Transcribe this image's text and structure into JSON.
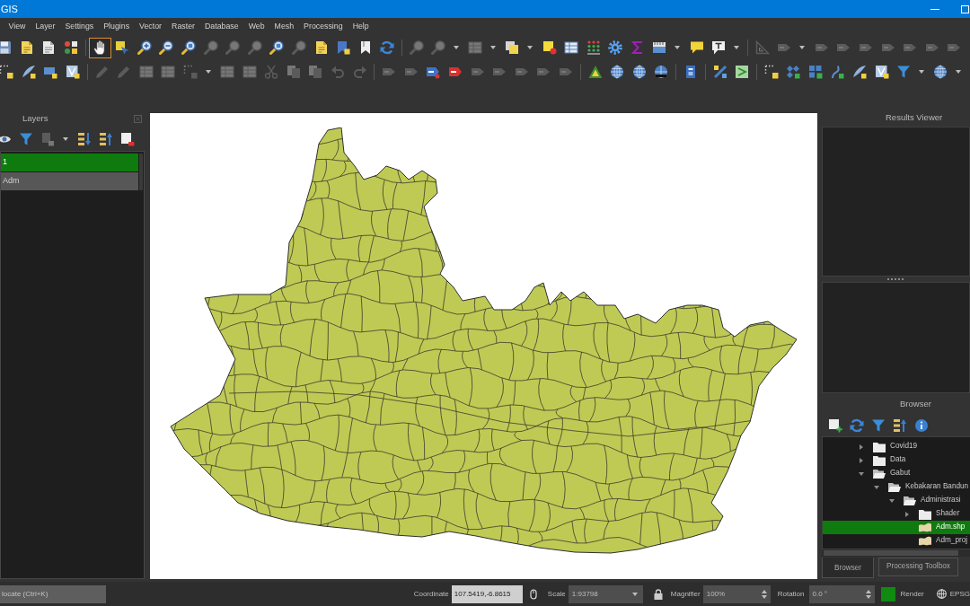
{
  "window": {
    "title": "GIS"
  },
  "menu_bar": [
    "View",
    "Layer",
    "Settings",
    "Plugins",
    "Vector",
    "Raster",
    "Database",
    "Web",
    "Mesh",
    "Processing",
    "Help"
  ],
  "toolbars": [
    {
      "groups": [
        [
          {
            "kind": "floppy",
            "disabled": false,
            "selected": false,
            "menu": false
          },
          {
            "kind": "page-star",
            "disabled": false,
            "selected": false,
            "menu": false
          },
          {
            "kind": "page",
            "disabled": false,
            "selected": false,
            "menu": false
          },
          {
            "kind": "dots",
            "disabled": false,
            "selected": false,
            "menu": false
          }
        ],
        [
          {
            "kind": "hand",
            "disabled": false,
            "selected": true,
            "menu": false
          },
          {
            "kind": "pan-select",
            "disabled": false,
            "selected": false,
            "menu": false
          },
          {
            "kind": "zoom-in",
            "disabled": false,
            "selected": false,
            "menu": false
          },
          {
            "kind": "zoom-out",
            "disabled": false,
            "selected": false,
            "menu": false
          },
          {
            "kind": "zoom-full",
            "disabled": false,
            "selected": false,
            "menu": false
          },
          {
            "kind": "magnifier",
            "disabled": true,
            "selected": false,
            "menu": false
          },
          {
            "kind": "magnifier",
            "disabled": true,
            "selected": false,
            "menu": false
          },
          {
            "kind": "magnifier",
            "disabled": true,
            "selected": false,
            "menu": false
          },
          {
            "kind": "zoom-full",
            "disabled": false,
            "selected": false,
            "menu": false
          },
          {
            "kind": "magnifier",
            "disabled": true,
            "selected": false,
            "menu": false
          },
          {
            "kind": "page-star",
            "disabled": false,
            "selected": false,
            "menu": false
          },
          {
            "kind": "bookmark-blue",
            "disabled": false,
            "selected": false,
            "menu": false
          },
          {
            "kind": "bookmark",
            "disabled": false,
            "selected": false,
            "menu": false
          },
          {
            "kind": "refresh",
            "disabled": false,
            "selected": false,
            "menu": false
          }
        ],
        [
          {
            "kind": "magnifier",
            "disabled": true,
            "selected": false,
            "menu": false
          },
          {
            "kind": "magnifier",
            "disabled": true,
            "selected": false,
            "menu": true
          },
          {
            "kind": "table",
            "disabled": true,
            "selected": false,
            "menu": true
          },
          {
            "kind": "layers",
            "disabled": false,
            "selected": false,
            "menu": true
          },
          {
            "kind": "square-dot",
            "disabled": false,
            "selected": false,
            "menu": false
          },
          {
            "kind": "table",
            "disabled": false,
            "selected": false,
            "menu": false
          },
          {
            "kind": "dot-grid",
            "disabled": false,
            "selected": false,
            "menu": false
          },
          {
            "kind": "gear",
            "disabled": false,
            "selected": false,
            "menu": false
          },
          {
            "kind": "sigma",
            "disabled": false,
            "selected": false,
            "menu": false
          },
          {
            "kind": "chart",
            "disabled": false,
            "selected": false,
            "menu": true
          },
          {
            "kind": "speech",
            "disabled": false,
            "selected": false,
            "menu": false
          },
          {
            "kind": "text-note",
            "disabled": false,
            "selected": false,
            "menu": true
          }
        ],
        [
          {
            "kind": "set-square",
            "disabled": true,
            "selected": false,
            "menu": false
          },
          {
            "kind": "label",
            "disabled": true,
            "selected": false,
            "menu": true
          },
          {
            "kind": "label",
            "disabled": true,
            "selected": false,
            "menu": false
          },
          {
            "kind": "label",
            "disabled": true,
            "selected": false,
            "menu": false
          },
          {
            "kind": "label",
            "disabled": true,
            "selected": false,
            "menu": false
          },
          {
            "kind": "label",
            "disabled": true,
            "selected": false,
            "menu": false
          },
          {
            "kind": "label",
            "disabled": true,
            "selected": false,
            "menu": false
          },
          {
            "kind": "label",
            "disabled": true,
            "selected": false,
            "menu": false
          },
          {
            "kind": "label",
            "disabled": true,
            "selected": false,
            "menu": false
          }
        ]
      ]
    },
    {
      "groups": [
        [
          {
            "kind": "vertex",
            "disabled": false,
            "selected": false,
            "menu": false
          },
          {
            "kind": "feather",
            "disabled": false,
            "selected": false,
            "menu": false
          },
          {
            "kind": "rect",
            "disabled": false,
            "selected": false,
            "menu": false
          },
          {
            "kind": "polygon",
            "disabled": false,
            "selected": false,
            "menu": false
          }
        ],
        [
          {
            "kind": "pencil",
            "disabled": true,
            "selected": false,
            "menu": false
          },
          {
            "kind": "pencil",
            "disabled": true,
            "selected": false,
            "menu": false
          },
          {
            "kind": "table",
            "disabled": true,
            "selected": false,
            "menu": false
          },
          {
            "kind": "table",
            "disabled": true,
            "selected": false,
            "menu": false
          },
          {
            "kind": "vertex",
            "disabled": true,
            "selected": false,
            "menu": true
          },
          {
            "kind": "table",
            "disabled": true,
            "selected": false,
            "menu": false
          },
          {
            "kind": "table",
            "disabled": true,
            "selected": false,
            "menu": false
          },
          {
            "kind": "scissors",
            "disabled": true,
            "selected": false,
            "menu": false
          },
          {
            "kind": "copy",
            "disabled": true,
            "selected": false,
            "menu": false
          },
          {
            "kind": "copy",
            "disabled": true,
            "selected": false,
            "menu": false
          },
          {
            "kind": "undo",
            "disabled": true,
            "selected": false,
            "menu": false
          },
          {
            "kind": "redo",
            "disabled": true,
            "selected": false,
            "menu": false
          }
        ],
        [
          {
            "kind": "label",
            "disabled": true,
            "selected": false,
            "menu": false
          },
          {
            "kind": "label",
            "disabled": true,
            "selected": false,
            "menu": false
          },
          {
            "kind": "abc-blue",
            "disabled": false,
            "selected": false,
            "menu": false
          },
          {
            "kind": "abc-red",
            "disabled": false,
            "selected": false,
            "menu": false
          },
          {
            "kind": "label",
            "disabled": true,
            "selected": false,
            "menu": false
          },
          {
            "kind": "label",
            "disabled": true,
            "selected": false,
            "menu": false
          },
          {
            "kind": "label",
            "disabled": true,
            "selected": false,
            "menu": false
          },
          {
            "kind": "label",
            "disabled": true,
            "selected": false,
            "menu": false
          },
          {
            "kind": "label",
            "disabled": true,
            "selected": false,
            "menu": false
          }
        ],
        [
          {
            "kind": "triangle",
            "disabled": false,
            "selected": false,
            "menu": false
          },
          {
            "kind": "globe",
            "disabled": false,
            "selected": false,
            "menu": false
          },
          {
            "kind": "globe",
            "disabled": false,
            "selected": false,
            "menu": false
          },
          {
            "kind": "globe-dark",
            "disabled": false,
            "selected": false,
            "menu": false
          }
        ],
        [
          {
            "kind": "book",
            "disabled": false,
            "selected": false,
            "menu": false
          }
        ],
        [
          {
            "kind": "satellite",
            "disabled": false,
            "selected": false,
            "menu": false
          },
          {
            "kind": "map",
            "disabled": false,
            "selected": false,
            "menu": false
          }
        ],
        [
          {
            "kind": "vertex",
            "disabled": false,
            "selected": false,
            "menu": false
          },
          {
            "kind": "puzzle",
            "disabled": false,
            "selected": false,
            "menu": false
          },
          {
            "kind": "grid",
            "disabled": false,
            "selected": false,
            "menu": false
          },
          {
            "kind": "curve",
            "disabled": false,
            "selected": false,
            "menu": false
          },
          {
            "kind": "feather",
            "disabled": false,
            "selected": false,
            "menu": false
          },
          {
            "kind": "polygon",
            "disabled": false,
            "selected": false,
            "menu": false
          },
          {
            "kind": "funnel",
            "disabled": false,
            "selected": false,
            "menu": true
          },
          {
            "kind": "globe",
            "disabled": false,
            "selected": false,
            "menu": true
          }
        ]
      ]
    }
  ],
  "layers_panel": {
    "title": "Layers",
    "toolbar": [
      {
        "kind": "eye",
        "disabled": false,
        "menu": false
      },
      {
        "kind": "funnel",
        "disabled": false,
        "menu": false
      },
      {
        "kind": "doc-plus",
        "disabled": true,
        "menu": true
      },
      {
        "kind": "list-down",
        "disabled": false,
        "menu": false
      },
      {
        "kind": "list-up",
        "disabled": false,
        "menu": false
      },
      {
        "kind": "doc-minus",
        "disabled": false,
        "menu": false
      }
    ],
    "layers": [
      {
        "name": "1",
        "selected": true
      },
      {
        "name": "Adm",
        "selected": false
      }
    ]
  },
  "results_viewer": {
    "title": "Results Viewer"
  },
  "browser": {
    "title": "Browser",
    "tree": [
      {
        "name": "Covid19",
        "kind": "folder",
        "expanded": false,
        "selected": false
      },
      {
        "name": "Data",
        "kind": "folder",
        "expanded": false,
        "selected": false
      },
      {
        "name": "Gabut",
        "kind": "folder",
        "expanded": true,
        "selected": false,
        "children": [
          {
            "name": "Kebakaran Bandun",
            "kind": "folder",
            "expanded": true,
            "selected": false,
            "children": [
              {
                "name": "Administrasi",
                "kind": "folder",
                "expanded": true,
                "selected": false,
                "children": [
                  {
                    "name": "Shader",
                    "kind": "folder",
                    "expanded": false,
                    "selected": false
                  },
                  {
                    "name": "Adm.shp",
                    "kind": "layer",
                    "selected": true
                  },
                  {
                    "name": "Adm_proj",
                    "kind": "layer",
                    "selected": false
                  }
                ]
              }
            ]
          }
        ]
      }
    ],
    "tabs": [
      {
        "label": "Browser",
        "selected": true
      },
      {
        "label": "Processing Toolbox",
        "selected": false
      }
    ]
  },
  "status_bar": {
    "locate_field": {
      "placeholder": "locate (Ctrl+K)"
    },
    "coordinate": {
      "label": "Coordinate",
      "value": "107.5419,-6.8615"
    },
    "scale": {
      "label": "Scale",
      "value": "1:93798"
    },
    "magnifier": {
      "label": "Magnifier",
      "value": "100%"
    },
    "rotation": {
      "label": "Rotation",
      "value": "0.0 °"
    },
    "render": {
      "label": "Render",
      "checked": true
    },
    "crs": "EPSG"
  }
}
